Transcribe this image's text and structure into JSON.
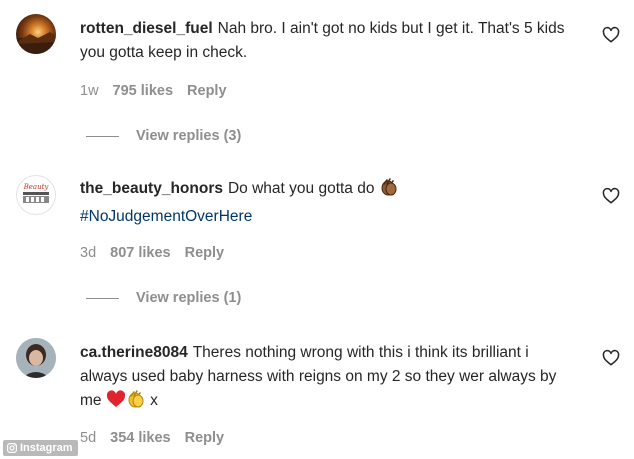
{
  "comments": [
    {
      "username": "rotten_diesel_fuel",
      "text": "Nah bro. I ain't got no kids but I get it. That's 5 kids you gotta keep in check.",
      "time": "1w",
      "likes": "795 likes",
      "reply": "Reply",
      "view_replies": "View replies (3)"
    },
    {
      "username": "the_beauty_honors",
      "text": "Do what you gotta do",
      "hashtag": "#NoJudgementOverHere",
      "time": "3d",
      "likes": "807 likes",
      "reply": "Reply",
      "view_replies": "View replies (1)",
      "avatar_logo_text": "Beauty"
    },
    {
      "username": "ca.therine8084",
      "text": "Theres nothing wrong with this i think its brilliant i always used baby harness with reigns on my 2 so they wer always by me",
      "text_suffix": "x",
      "time": "5d",
      "likes": "354 likes",
      "reply": "Reply"
    }
  ],
  "watermark": "Instagram",
  "icons": {
    "like": "heart-outline-icon",
    "emoji_1": "clapping-hands-emoji",
    "emoji_2": "red-heart-emoji"
  },
  "colors": {
    "text": "#262626",
    "secondary": "#8e8e8e",
    "hashtag": "#00376b"
  }
}
